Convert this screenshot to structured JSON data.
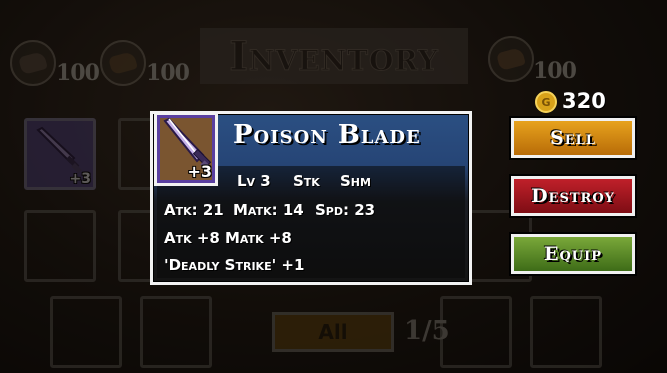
{
  "screen": {
    "title": "Inventory"
  },
  "resources": [
    {
      "icon": "stone-ore-icon",
      "count": "100"
    },
    {
      "icon": "wood-log-icon",
      "count": "100"
    },
    {
      "icon": "leather-hide-icon",
      "count": "100"
    }
  ],
  "gold": {
    "icon": "gold-coin-icon",
    "amount": "320"
  },
  "slot_badge": "+3",
  "pagination": {
    "filter_label": "All",
    "page": "1/5"
  },
  "item": {
    "name": "Poison Blade",
    "icon": "purple-dagger-icon",
    "upgrade": "+3",
    "level": "Lv 3",
    "tag1": "Stk",
    "tag2": "Shm",
    "atk": "Atk: 21",
    "matk": "Matk: 14",
    "spd": "Spd: 23",
    "bonus_atk": "Atk +8",
    "bonus_matk": "Matk +8",
    "skill": "'Deadly Strike' +1"
  },
  "actions": {
    "sell": "Sell",
    "destroy": "Destroy",
    "equip": "Equip"
  },
  "colors": {
    "sell": "#d88a14",
    "destroy": "#a6141e",
    "equip": "#5c8a28",
    "card_top": "#2b4f82",
    "item_frame": "#5a3fa0"
  }
}
